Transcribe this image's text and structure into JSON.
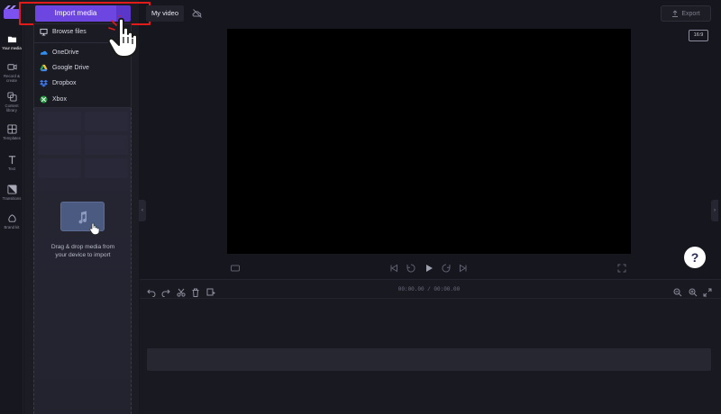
{
  "toolbar": {
    "import_label": "Import media",
    "project_name": "My video",
    "export_label": "Export",
    "aspect_ratio": "16:9"
  },
  "rail": {
    "items": [
      {
        "label": "Your media",
        "icon": "folder-icon"
      },
      {
        "label": "Record & create",
        "icon": "camera-icon"
      },
      {
        "label": "Content library",
        "icon": "library-icon"
      },
      {
        "label": "Templates",
        "icon": "templates-icon"
      },
      {
        "label": "Text",
        "icon": "text-icon"
      },
      {
        "label": "Transitions",
        "icon": "transitions-icon"
      },
      {
        "label": "Brand kit",
        "icon": "brand-kit-icon"
      }
    ]
  },
  "dropdown": {
    "items": [
      {
        "label": "Browse files",
        "icon": "monitor-icon"
      },
      {
        "label": "OneDrive",
        "icon": "onedrive-icon"
      },
      {
        "label": "Google Drive",
        "icon": "google-drive-icon"
      },
      {
        "label": "Dropbox",
        "icon": "dropbox-icon"
      },
      {
        "label": "Xbox",
        "icon": "xbox-icon"
      }
    ]
  },
  "dropzone": {
    "text_line1": "Drag & drop media from",
    "text_line2": "your device to import"
  },
  "timeline": {
    "timecode": "00:00.00 / 00:00.00"
  },
  "help": {
    "label": "?"
  },
  "colors": {
    "accent": "#6d45e0",
    "highlight": "#e11a1a",
    "background": "#16161e"
  }
}
